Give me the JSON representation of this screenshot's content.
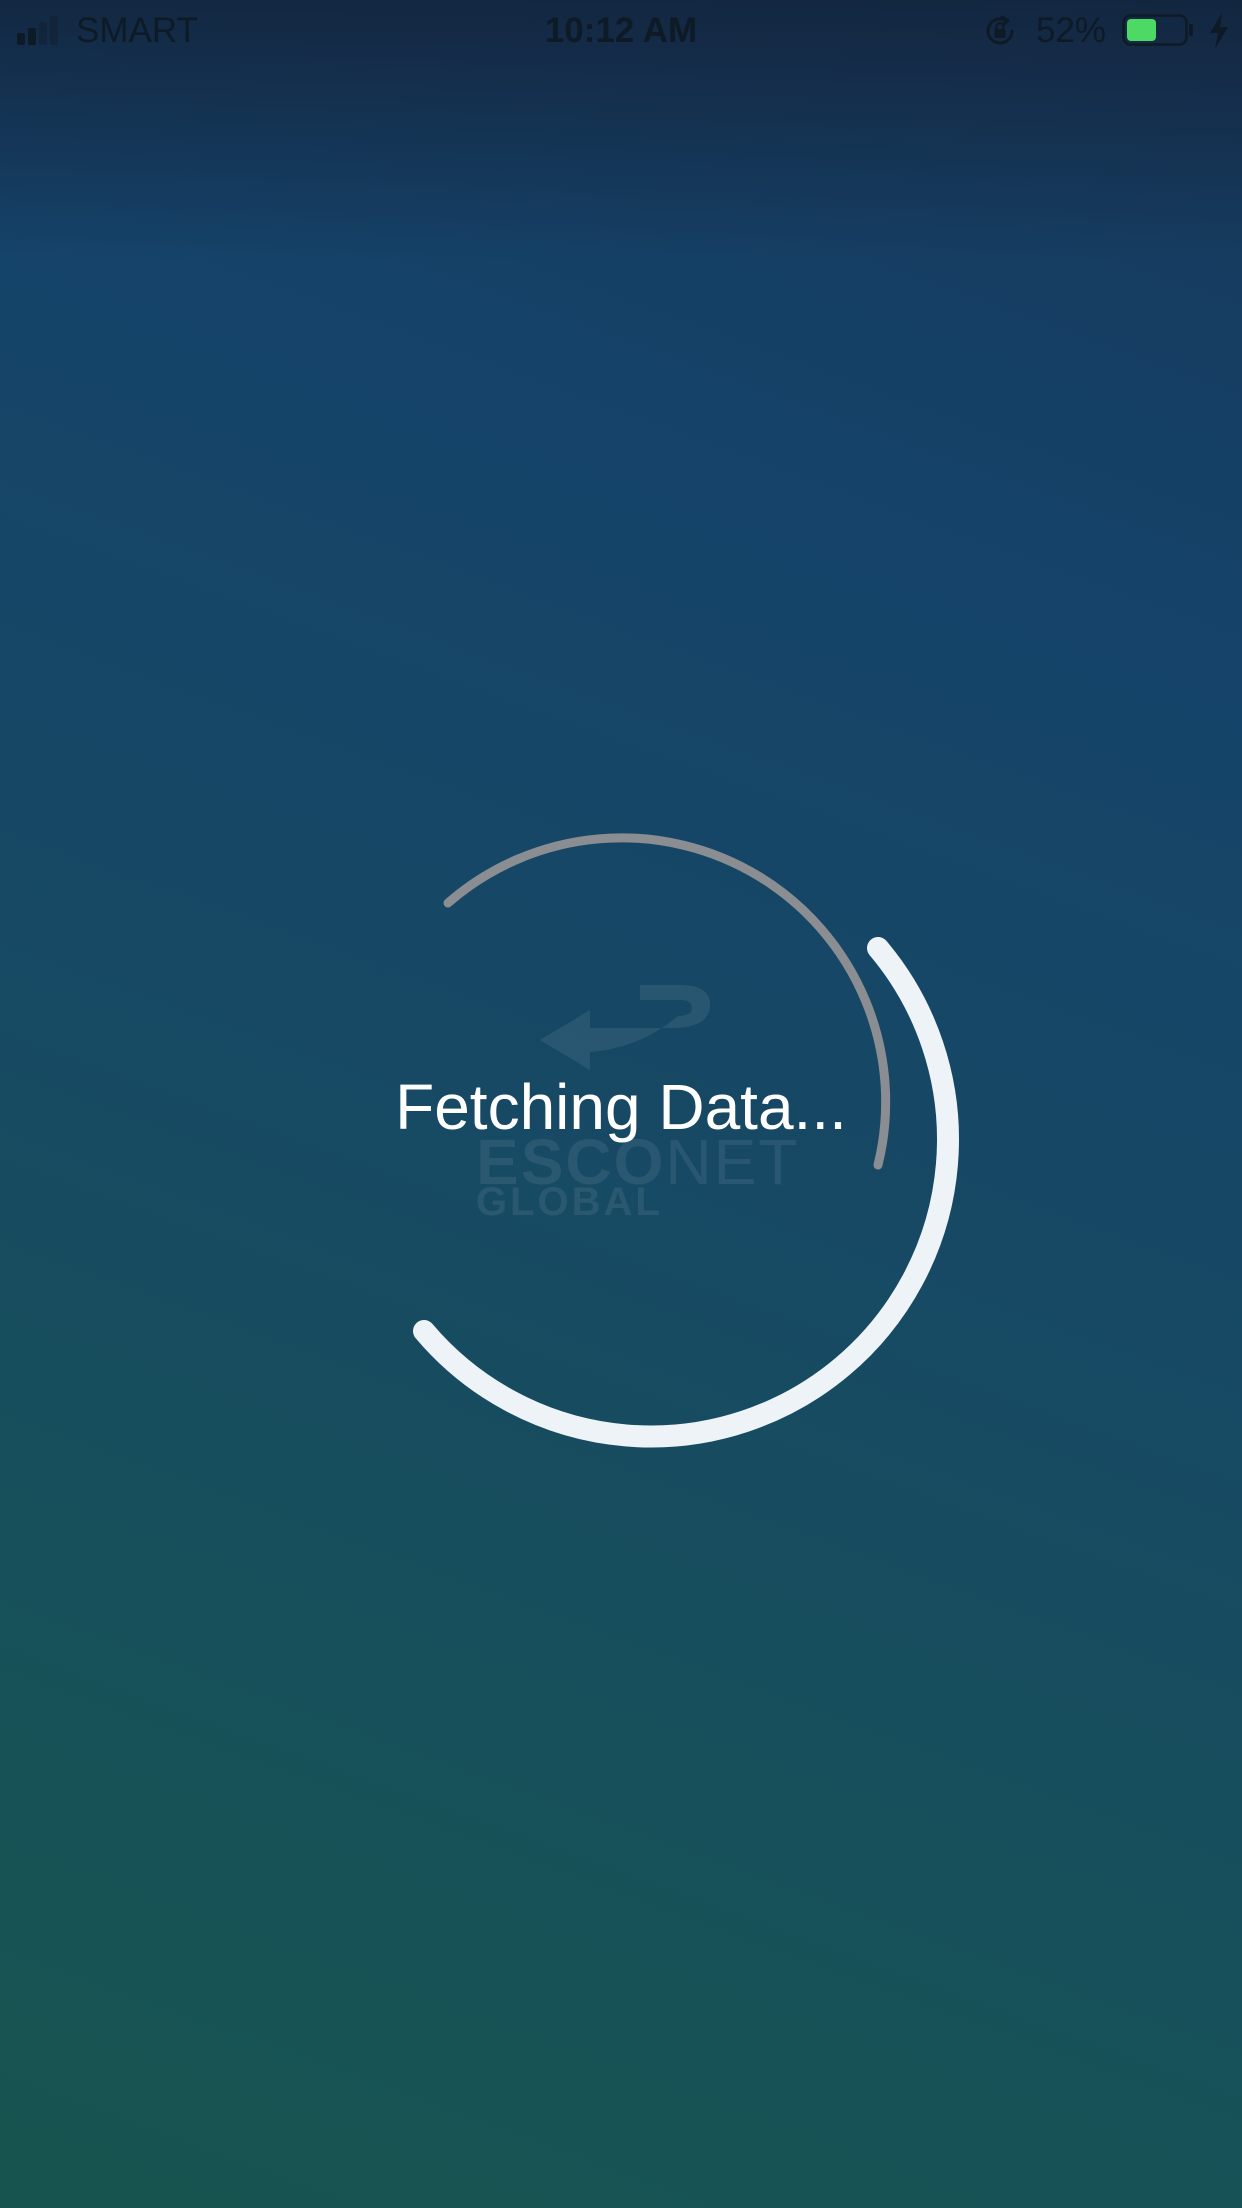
{
  "status_bar": {
    "carrier": "SMART",
    "time": "10:12 AM",
    "battery_percent": "52%",
    "battery_level": 0.52,
    "signal_bars_active": 2,
    "signal_bars_total": 4,
    "icons": [
      "signal-icon",
      "orientation-lock-icon",
      "battery-icon",
      "charging-icon"
    ]
  },
  "loader": {
    "message": "Fetching Data...",
    "watermark": {
      "line1": "ESCO",
      "line1_b": "NET",
      "line2": "GLOBAL"
    }
  },
  "colors": {
    "background_top": "#16385a",
    "background_bottom": "#17544f",
    "spinner_outer": "#eef3f8",
    "spinner_inner": "#8a8d92",
    "battery_fill": "#4cd964",
    "status_text": "#0e1a26"
  }
}
